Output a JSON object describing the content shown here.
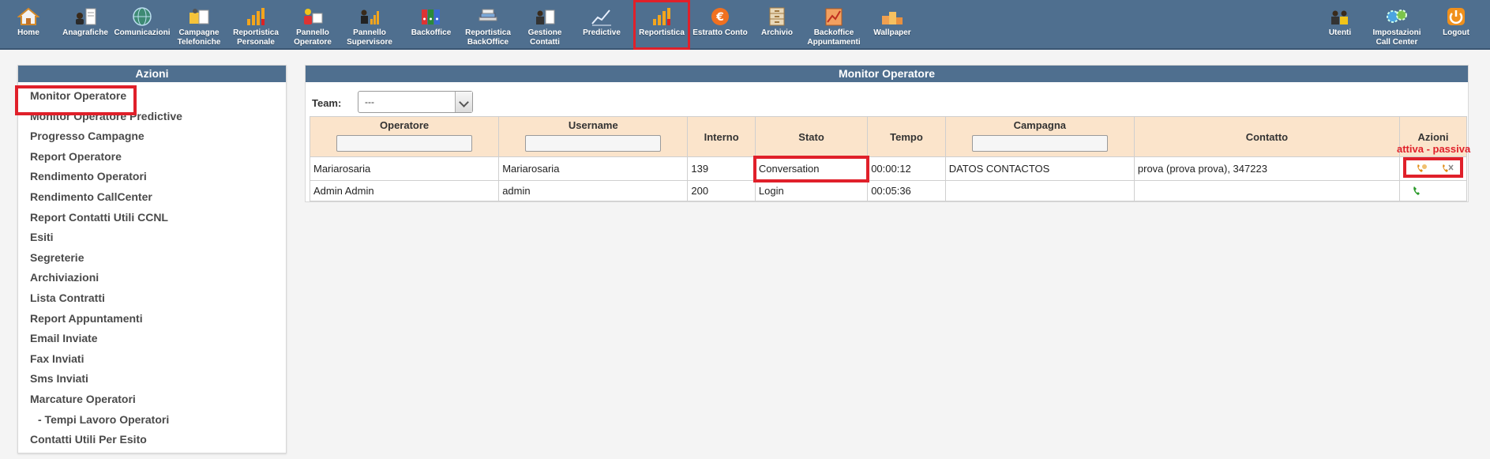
{
  "toolbar": {
    "items": [
      {
        "label": "Home",
        "icon": "home-icon"
      },
      {
        "label": "Anagrafiche",
        "icon": "contacts-icon"
      },
      {
        "label": "Comunicazioni",
        "icon": "globe-icon"
      },
      {
        "label": "Campagne\nTelefoniche",
        "icon": "phone-campaign-icon"
      },
      {
        "label": "Reportistica\nPersonale",
        "icon": "bar-chart-icon"
      },
      {
        "label": "Pannello\nOperatore",
        "icon": "operator-panel-icon"
      },
      {
        "label": "Pannello\nSupervisore",
        "icon": "supervisor-panel-icon"
      },
      {
        "label": "Backoffice",
        "icon": "binders-icon"
      },
      {
        "label": "Reportistica\nBackOffice",
        "icon": "documents-stack-icon"
      },
      {
        "label": "Gestione\nContatti",
        "icon": "contact-management-icon"
      },
      {
        "label": "Predictive",
        "icon": "line-chart-icon"
      },
      {
        "label": "Reportistica",
        "icon": "bar-chart-icon",
        "active": true
      },
      {
        "label": "Estratto Conto",
        "icon": "euro-icon"
      },
      {
        "label": "Archivio",
        "icon": "archive-cabinet-icon"
      },
      {
        "label": "Backoffice\nAppuntamenti",
        "icon": "calendar-icon"
      },
      {
        "label": "Wallpaper",
        "icon": "podium-icon"
      }
    ],
    "right_items": [
      {
        "label": "Utenti",
        "icon": "users-icon"
      },
      {
        "label": "Impostazioni\nCall Center",
        "icon": "gears-icon"
      },
      {
        "label": "Logout",
        "icon": "power-icon"
      }
    ]
  },
  "sidebar": {
    "title": "Azioni",
    "items": [
      {
        "label": "Monitor Operatore",
        "selected": true
      },
      {
        "label": "Monitor Operatore Predictive"
      },
      {
        "label": "Progresso Campagne"
      },
      {
        "label": "Report Operatore"
      },
      {
        "label": "Rendimento Operatori"
      },
      {
        "label": "Rendimento CallCenter"
      },
      {
        "label": "Report Contatti Utili CCNL"
      },
      {
        "label": "Esiti"
      },
      {
        "label": "Segreterie"
      },
      {
        "label": "Archiviazioni"
      },
      {
        "label": "Lista Contratti"
      },
      {
        "label": "Report Appuntamenti"
      },
      {
        "label": "Email Inviate"
      },
      {
        "label": "Fax Inviati"
      },
      {
        "label": "Sms Inviati"
      },
      {
        "label": "Marcature Operatori"
      },
      {
        "label": "- Tempi Lavoro Operatori",
        "sub": true
      },
      {
        "label": "Contatti Utili Per Esito"
      }
    ]
  },
  "main": {
    "title": "Monitor Operatore",
    "team_label": "Team:",
    "team_value": "---",
    "columns": [
      "Operatore",
      "Username",
      "Interno",
      "Stato",
      "Tempo",
      "Campagna",
      "Contatto",
      "Azioni"
    ],
    "rows": [
      {
        "operatore": "Mariarosaria",
        "username": "Mariarosaria",
        "interno": "139",
        "stato": "Conversation",
        "tempo": "00:00:12",
        "campagna": "DATOS CONTACTOS",
        "contatto": "prova (prova prova), 347223"
      },
      {
        "operatore": "Admin Admin",
        "username": "admin",
        "interno": "200",
        "stato": "Login",
        "tempo": "00:05:36",
        "campagna": "",
        "contatto": ""
      }
    ],
    "azioni_note": "attiva - passiva"
  },
  "colors": {
    "toolbar_bg": "#4f6f8f",
    "header_cell_bg": "#fbe4cb",
    "highlight_red": "#e0202a"
  }
}
